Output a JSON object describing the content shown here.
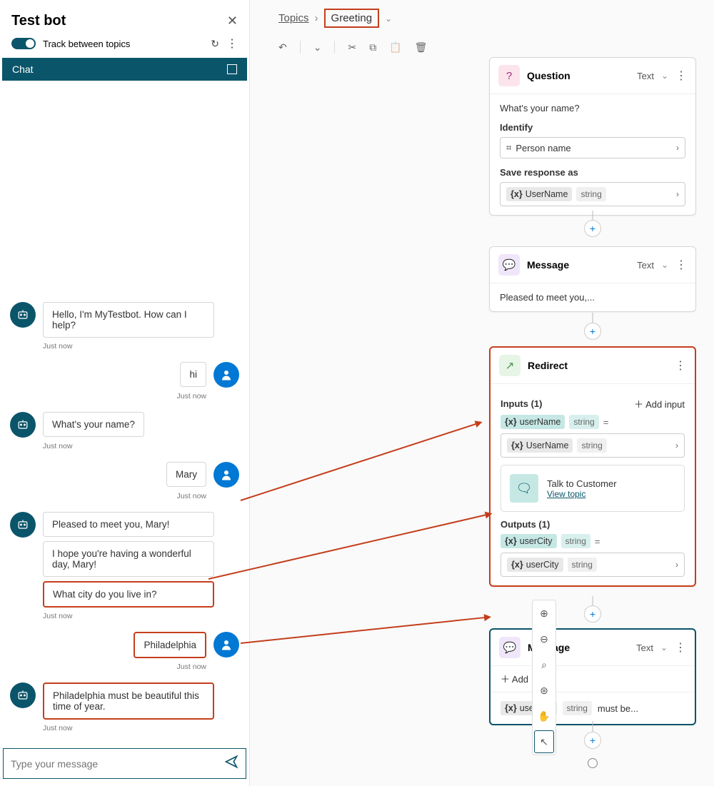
{
  "panel": {
    "title": "Test bot",
    "track_label": "Track between topics",
    "chat_tab": "Chat",
    "input_placeholder": "Type your message"
  },
  "messages": {
    "m0": "Hello, I'm MyTestbot. How can I help?",
    "t0": "Just now",
    "u0": "hi",
    "tu0": "Just now",
    "m1": "What's your name?",
    "t1": "Just now",
    "u1": "Mary",
    "tu1": "Just now",
    "m2a": "Pleased to meet you, Mary!",
    "m2b": "I hope you're having a wonderful day, Mary!",
    "m2c": "What city do you live in?",
    "t2": "Just now",
    "u2": "Philadelphia",
    "tu2": "Just now",
    "m3": "Philadelphia must be beautiful this time of year.",
    "t3": "Just now"
  },
  "breadcrumb": {
    "topics": "Topics",
    "current": "Greeting"
  },
  "nodes": {
    "question": {
      "title": "Question",
      "mode": "Text",
      "prompt": "What's your name?",
      "identify_lbl": "Identify",
      "identify_val": "Person name",
      "save_lbl": "Save response as",
      "save_var": "UserName",
      "save_type": "string"
    },
    "message1": {
      "title": "Message",
      "mode": "Text",
      "text": "Pleased to meet you,..."
    },
    "redirect": {
      "title": "Redirect",
      "inputs_lbl": "Inputs (1)",
      "add_input": "Add input",
      "in_var": "userName",
      "in_type": "string",
      "in_val_var": "UserName",
      "in_val_type": "string",
      "talk_title": "Talk to Customer",
      "talk_link": "View topic",
      "outputs_lbl": "Outputs (1)",
      "out_var": "userCity",
      "out_type": "string",
      "out_val_var": "userCity",
      "out_val_type": "string"
    },
    "message2": {
      "title": "Message",
      "mode": "Text",
      "add": "Add",
      "var": "userCity",
      "type": "string",
      "suffix": "must be..."
    }
  }
}
